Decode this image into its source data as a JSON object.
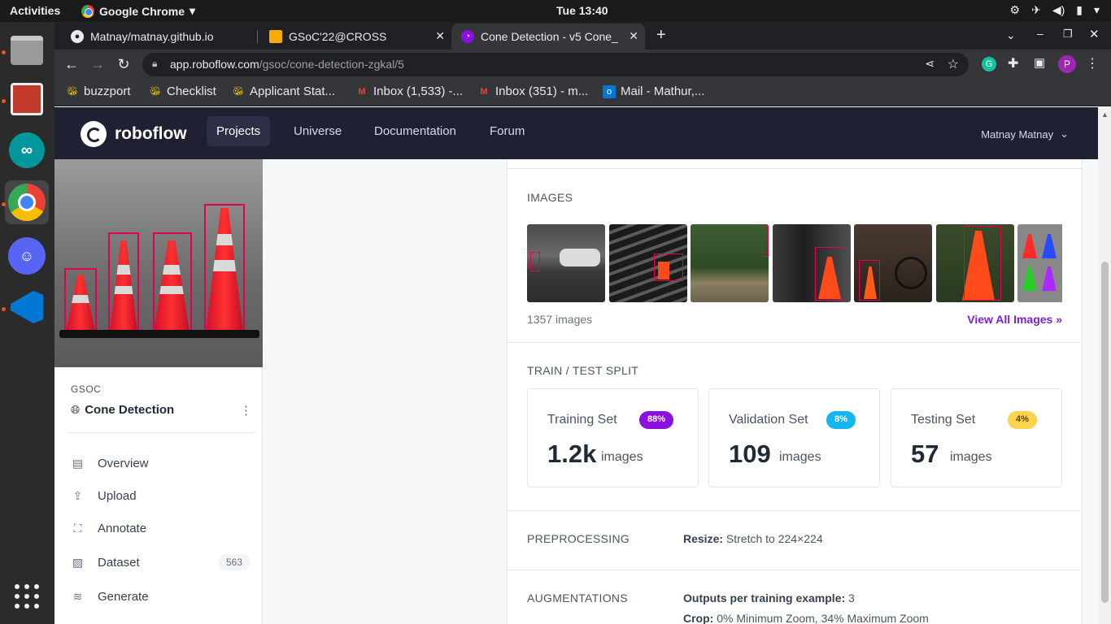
{
  "system": {
    "activities": "Activities",
    "app_name": "Google Chrome",
    "clock": "Tue 13:40"
  },
  "browser": {
    "tabs": [
      {
        "title": "Matnay/matnay.github.io",
        "favicon": "github-icon"
      },
      {
        "title": "GSoC'22@CROSS",
        "favicon": "gsoc-icon"
      },
      {
        "title": "Cone Detection - v5 Cone_",
        "favicon": "roboflow-icon",
        "active": true
      }
    ],
    "url_domain": "app.roboflow.com",
    "url_path": "/gsoc/cone-detection-zgkal/5",
    "profile_initial": "P",
    "bookmarks": [
      {
        "label": "buzzport",
        "icon": "bee-icon"
      },
      {
        "label": "Checklist",
        "icon": "bee-icon"
      },
      {
        "label": "Applicant Stat...",
        "icon": "bee-icon"
      },
      {
        "label": "Inbox (1,533) -...",
        "icon": "gmail-icon"
      },
      {
        "label": "Inbox (351) - m...",
        "icon": "gmail-icon"
      },
      {
        "label": "Mail - Mathur,...",
        "icon": "outlook-icon"
      }
    ]
  },
  "nav": {
    "brand": "roboflow",
    "links": [
      "Projects",
      "Universe",
      "Documentation",
      "Forum"
    ],
    "active": "Projects",
    "user": "Matnay Matnay"
  },
  "sidebar": {
    "org": "GSOC",
    "project": "Cone Detection",
    "items": [
      {
        "label": "Overview",
        "icon": "book-icon"
      },
      {
        "label": "Upload",
        "icon": "upload-icon"
      },
      {
        "label": "Annotate",
        "icon": "annotate-icon"
      },
      {
        "label": "Dataset",
        "icon": "images-icon",
        "count": "563"
      },
      {
        "label": "Generate",
        "icon": "layers-icon"
      }
    ]
  },
  "images": {
    "title": "IMAGES",
    "count": "1357 images",
    "view_all": "View All Images »"
  },
  "split": {
    "title": "TRAIN / TEST SPLIT",
    "sets": [
      {
        "label": "Training Set",
        "badge": "88%",
        "value": "1.2k",
        "unit": "images",
        "color": "#8b10e0"
      },
      {
        "label": "Validation Set",
        "badge": "8%",
        "value": "109",
        "unit": "images",
        "color": "#16b5f0"
      },
      {
        "label": "Testing Set",
        "badge": "4%",
        "value": "57",
        "unit": "images",
        "color": "#fcd34d"
      }
    ]
  },
  "preprocessing": {
    "title": "PREPROCESSING",
    "key": "Resize:",
    "value": "Stretch to 224×224"
  },
  "augmentations": {
    "title": "AUGMENTATIONS",
    "outputs_key": "Outputs per training example:",
    "outputs_value": "3",
    "crop_key": "Crop:",
    "crop_value": "0% Minimum Zoom, 34% Maximum Zoom"
  }
}
